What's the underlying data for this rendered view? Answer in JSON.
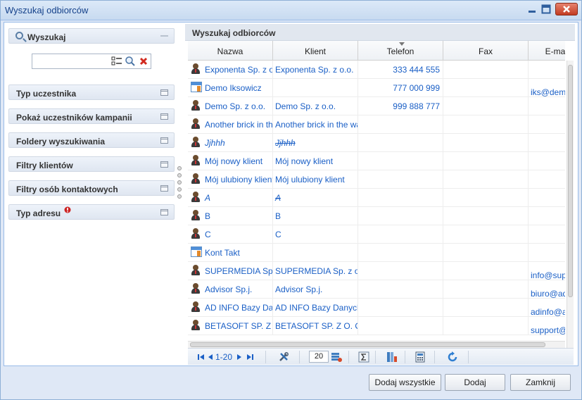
{
  "window": {
    "title": "Wyszukaj odbiorców"
  },
  "left_panel": {
    "search_section": {
      "label": "Wyszukaj"
    },
    "search_input": {
      "value": "",
      "placeholder": ""
    },
    "sections": [
      {
        "label": "Typ uczestnika",
        "badge": false
      },
      {
        "label": "Pokaż uczestników kampanii",
        "badge": false
      },
      {
        "label": "Foldery wyszukiwania",
        "badge": false
      },
      {
        "label": "Filtry klientów",
        "badge": false
      },
      {
        "label": "Filtry osób kontaktowych",
        "badge": false
      },
      {
        "label": "Typ adresu",
        "badge": true
      }
    ]
  },
  "grid": {
    "title": "Wyszukaj odbiorców",
    "columns": [
      "Nazwa",
      "Klient",
      "Telefon",
      "Fax",
      "E-mai"
    ],
    "sorted_column": "Telefon",
    "rows": [
      {
        "icon": "person-icon",
        "name": "Exponenta Sp. z o.o.",
        "client": "Exponenta Sp. z o.o.",
        "phone": "333 444 555",
        "fax": "",
        "email": "",
        "style": ""
      },
      {
        "icon": "company-card-icon",
        "name": "Demo Iksowicz",
        "client": "",
        "phone": "777 000 999",
        "fax": "",
        "email": "iks@demo",
        "style": ""
      },
      {
        "icon": "person-icon",
        "name": "Demo Sp. z o.o.",
        "client": "Demo Sp. z o.o.",
        "phone": "999 888 777",
        "fax": "",
        "email": "",
        "style": ""
      },
      {
        "icon": "person-icon",
        "name": "Another brick in the",
        "client": "Another brick in the wall",
        "phone": "",
        "fax": "",
        "email": "",
        "style": ""
      },
      {
        "icon": "person-icon",
        "name": "Jjhhh",
        "client": "Jjhhh",
        "phone": "",
        "fax": "",
        "email": "",
        "style": "italic-strike"
      },
      {
        "icon": "person-icon",
        "name": "Mój nowy klient",
        "client": "Mój nowy klient",
        "phone": "",
        "fax": "",
        "email": "",
        "style": ""
      },
      {
        "icon": "person-icon",
        "name": "Mój ulubiony klient",
        "client": "Mój ulubiony klient",
        "phone": "",
        "fax": "",
        "email": "",
        "style": ""
      },
      {
        "icon": "person-icon",
        "name": "A",
        "client": "A",
        "phone": "",
        "fax": "",
        "email": "",
        "style": "italic-strike"
      },
      {
        "icon": "person-icon",
        "name": "B",
        "client": "B",
        "phone": "",
        "fax": "",
        "email": "",
        "style": ""
      },
      {
        "icon": "person-icon",
        "name": "C",
        "client": "C",
        "phone": "",
        "fax": "",
        "email": "",
        "style": ""
      },
      {
        "icon": "company-card-icon",
        "name": "Kont Takt",
        "client": "",
        "phone": "",
        "fax": "",
        "email": "",
        "style": ""
      },
      {
        "icon": "person-icon",
        "name": "SUPERMEDIA Sp. z o",
        "client": "SUPERMEDIA Sp. z o.o.",
        "phone": "",
        "fax": "",
        "email": "info@supe",
        "style": ""
      },
      {
        "icon": "person-icon",
        "name": "Advisor Sp.j.",
        "client": "Advisor Sp.j.",
        "phone": "",
        "fax": "",
        "email": "biuro@adv",
        "style": ""
      },
      {
        "icon": "person-icon",
        "name": "AD INFO Bazy Dany",
        "client": "AD INFO Bazy Danych Pi",
        "phone": "",
        "fax": "",
        "email": "adinfo@ad",
        "style": ""
      },
      {
        "icon": "person-icon",
        "name": "BETASOFT SP. Z O. O",
        "client": "BETASOFT SP. Z O. O.",
        "phone": "",
        "fax": "",
        "email": "support@",
        "style": ""
      }
    ]
  },
  "pager": {
    "range": "1-20",
    "page_size": "20"
  },
  "footer": {
    "add_all": "Dodaj wszystkie",
    "add": "Dodaj",
    "close": "Zamknij"
  },
  "colors": {
    "link": "#1a5fc6",
    "title": "#15428b",
    "close_button": "#c23c22",
    "badge": "#cc2222"
  }
}
